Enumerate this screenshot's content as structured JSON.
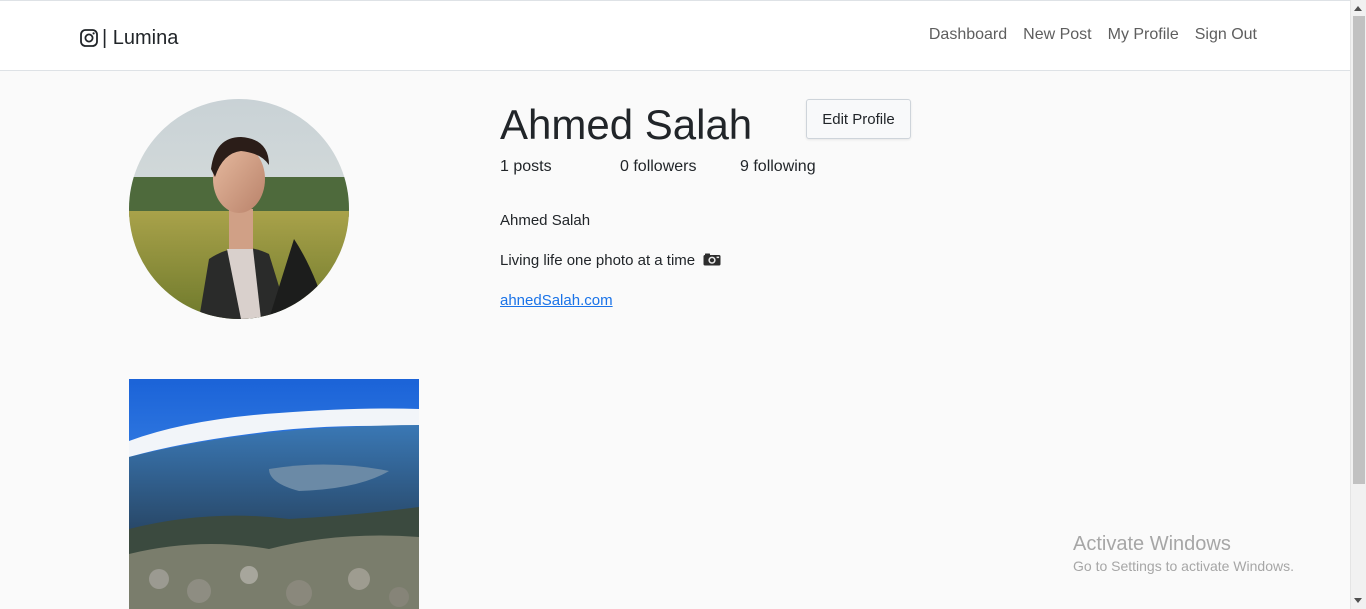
{
  "nav": {
    "brand_icon": "instagram-icon",
    "brand": "| Lumina",
    "links": [
      "Dashboard",
      "New Post",
      "My Profile",
      "Sign Out"
    ]
  },
  "profile": {
    "avatar_icon": "profile-photo",
    "username": "Ahmed Salah",
    "edit_button": "Edit Profile",
    "stats": {
      "posts": "1 posts",
      "followers": "0 followers",
      "following": "9 following"
    },
    "full_name": "Ahmed Salah",
    "bio": "Living life one photo at a time",
    "bio_icon": "camera-emoji",
    "website": "ahnedSalah.com"
  },
  "posts": [
    {
      "thumbnail_icon": "landscape-photo"
    }
  ],
  "watermark": {
    "title": "Activate Windows",
    "subtitle": "Go to Settings to activate Windows."
  },
  "colors": {
    "background": "#fafafa",
    "navbar": "#ffffff",
    "link": "#1a73e8",
    "text": "#212529",
    "nav_text": "#5e5e5e"
  }
}
